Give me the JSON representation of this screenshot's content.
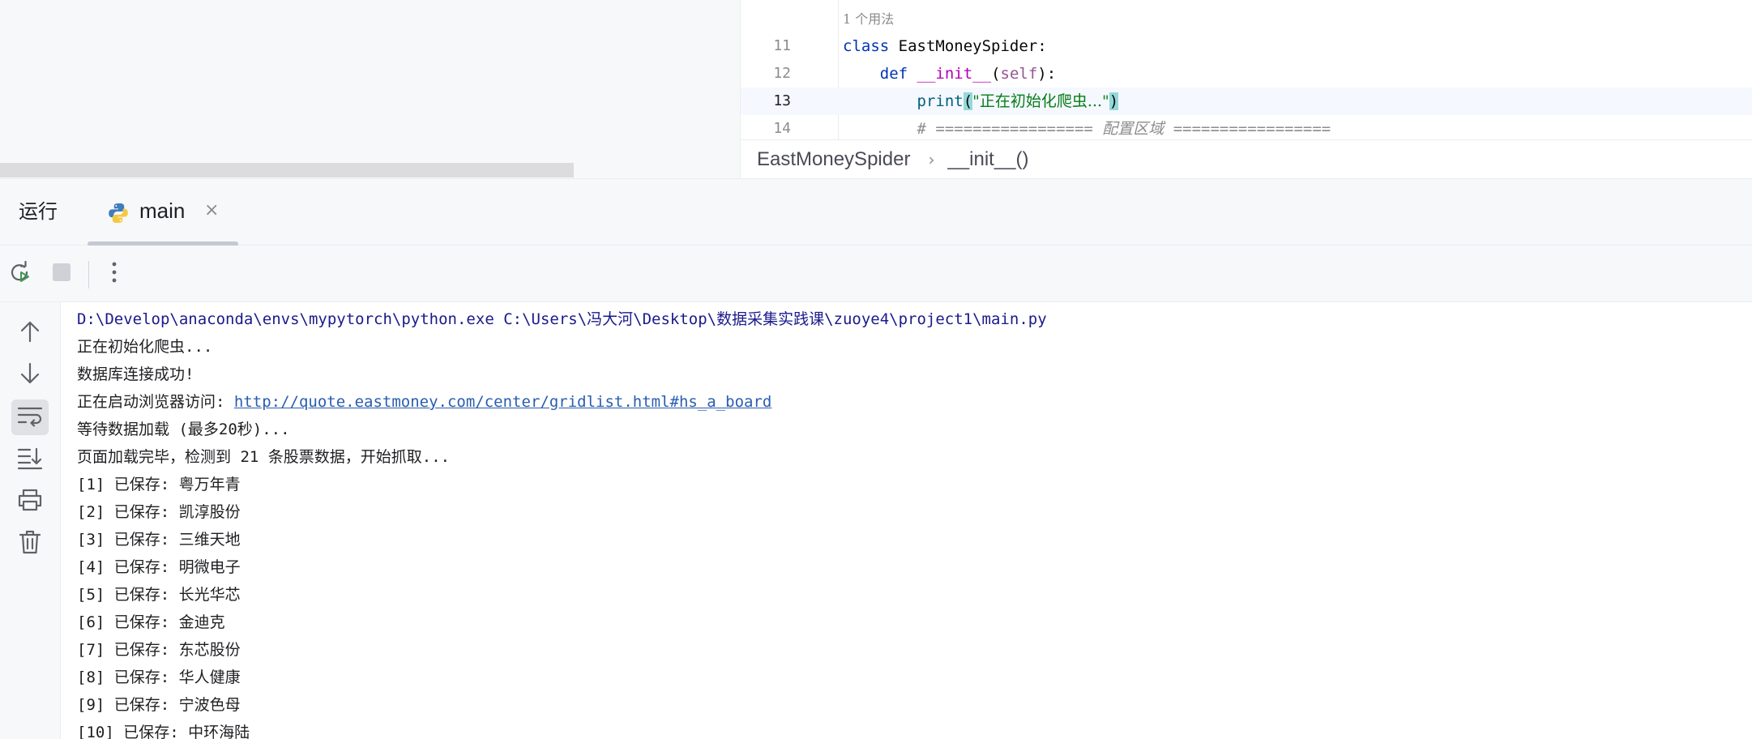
{
  "editor": {
    "usage_hint": "1 个用法",
    "lines": [
      {
        "no": "11"
      },
      {
        "no": "12"
      },
      {
        "no": "13"
      },
      {
        "no": "14"
      }
    ],
    "code": {
      "class_kw": "class",
      "class_name": " EastMoneySpider:",
      "def_indent": "    ",
      "def_kw": "def",
      "def_name": "__init__",
      "def_open": "(",
      "def_self": "self",
      "def_close": "):",
      "print_indent": "        ",
      "print_fn": "print",
      "print_open": "(",
      "print_str": "\"正在初始化爬虫...\"",
      "print_close": ")",
      "comment_indent": "        ",
      "comment": "# ================= 配置区域 ================="
    },
    "breadcrumb": {
      "class": "EastMoneySpider",
      "separator": "›",
      "method": "__init__()"
    }
  },
  "run_panel": {
    "title": "运行",
    "tab_label": "main",
    "tab_close": "×",
    "icons": {
      "rerun": "rerun-icon",
      "stop": "stop-icon",
      "more": "more-vertical-icon",
      "up": "arrow-up-icon",
      "down": "arrow-down-icon",
      "wrap": "soft-wrap-icon",
      "scroll_end": "scroll-to-end-icon",
      "print": "print-icon",
      "clear": "trash-icon"
    }
  },
  "console": {
    "command": "D:\\Develop\\anaconda\\envs\\mypytorch\\python.exe C:\\Users\\冯大河\\Desktop\\数据采集实践课\\zuoye4\\project1\\main.py",
    "lines": [
      "正在初始化爬虫...",
      "数据库连接成功!",
      "等待数据加载 (最多20秒)...",
      "页面加载完毕，检测到 21 条股票数据，开始抓取..."
    ],
    "browser_prefix": "正在启动浏览器访问: ",
    "browser_url": "http://quote.eastmoney.com/center/gridlist.html#hs_a_board",
    "saved": [
      "[1] 已保存: 粤万年青",
      "[2] 已保存: 凯淳股份",
      "[3] 已保存: 三维天地",
      "[4] 已保存: 明微电子",
      "[5] 已保存: 长光华芯",
      "[6] 已保存: 金迪克",
      "[7] 已保存: 东芯股份",
      "[8] 已保存: 华人健康",
      "[9] 已保存: 宁波色母",
      "[10] 已保存: 中环海陆"
    ]
  },
  "colors": {
    "keyword": "#0033b3",
    "string": "#067d17",
    "link": "#2a5db0",
    "panel_bg": "#f7f8fa"
  }
}
